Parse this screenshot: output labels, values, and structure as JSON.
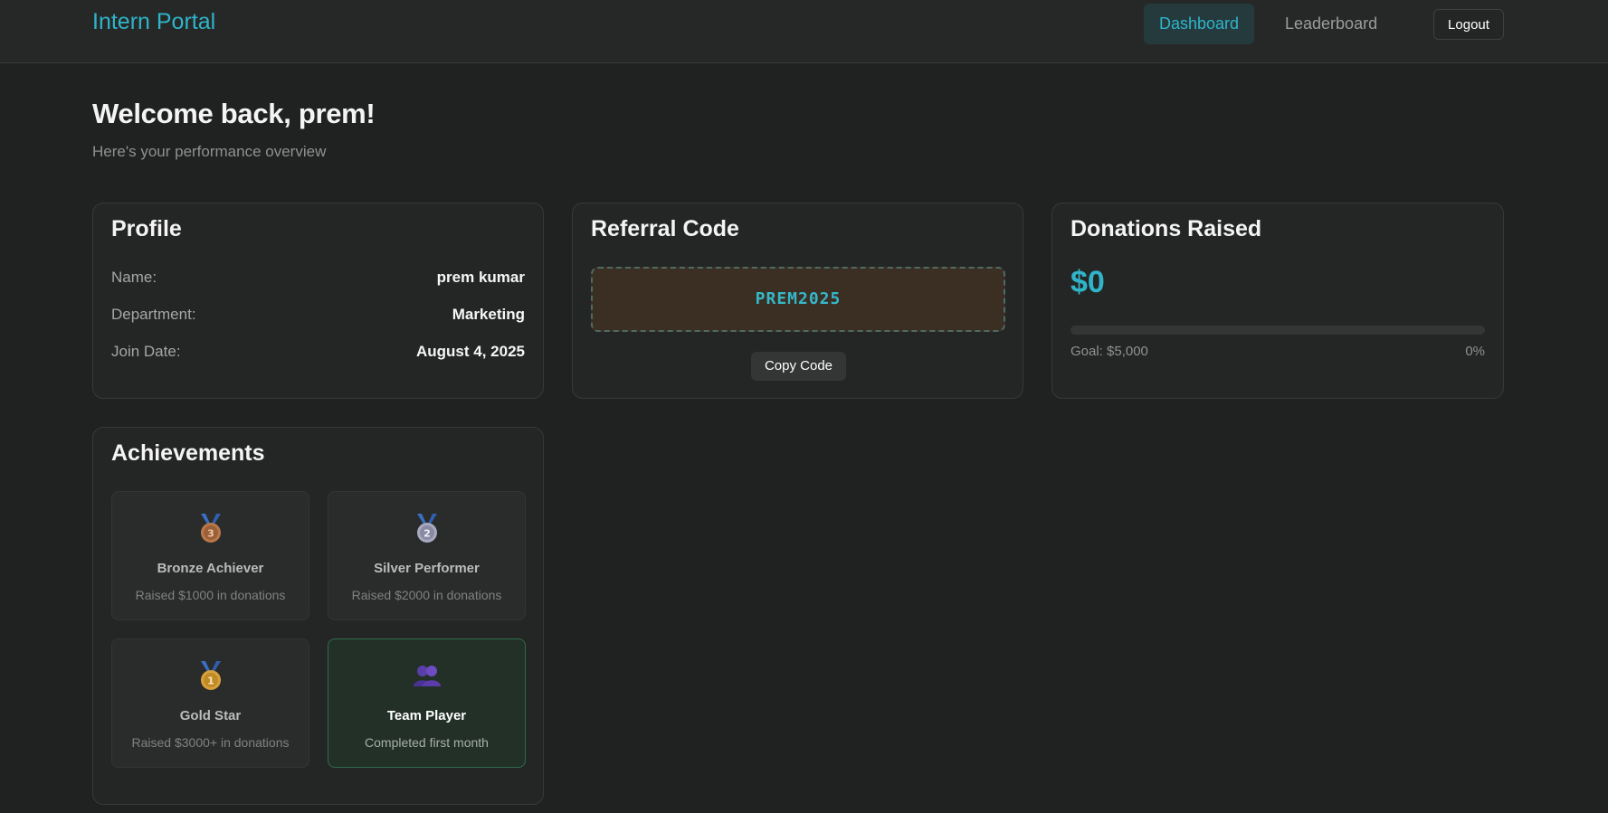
{
  "header": {
    "brand": "Intern Portal",
    "nav": [
      {
        "label": "Dashboard",
        "active": true
      },
      {
        "label": "Leaderboard",
        "active": false
      }
    ],
    "logout_label": "Logout"
  },
  "main": {
    "title": "Welcome back, prem!",
    "subtitle": "Here's your performance overview"
  },
  "profile": {
    "title": "Profile",
    "rows": [
      {
        "label": "Name:",
        "value": "prem kumar"
      },
      {
        "label": "Department:",
        "value": "Marketing"
      },
      {
        "label": "Join Date:",
        "value": "August 4, 2025"
      }
    ]
  },
  "referral": {
    "title": "Referral Code",
    "code": "PREM2025",
    "copy_label": "Copy Code"
  },
  "donations": {
    "title": "Donations Raised",
    "amount": "$0",
    "goal": "Goal: $5,000",
    "percent": "0%",
    "progress_fraction": 0
  },
  "achievements": {
    "title": "Achievements",
    "items": [
      {
        "name": "Bronze Achiever",
        "desc": "Raised $1000 in donations",
        "icon": "bronze-medal-icon",
        "earned": false
      },
      {
        "name": "Silver Performer",
        "desc": "Raised $2000 in donations",
        "icon": "silver-medal-icon",
        "earned": false
      },
      {
        "name": "Gold Star",
        "desc": "Raised $3000+ in donations",
        "icon": "gold-medal-icon",
        "earned": false
      },
      {
        "name": "Team Player",
        "desc": "Completed first month",
        "icon": "team-icon",
        "earned": true
      }
    ]
  },
  "colors": {
    "accent": "#2fb4c9",
    "background": "#202221",
    "card": "#242625",
    "earned_border": "#2d6b4c"
  }
}
